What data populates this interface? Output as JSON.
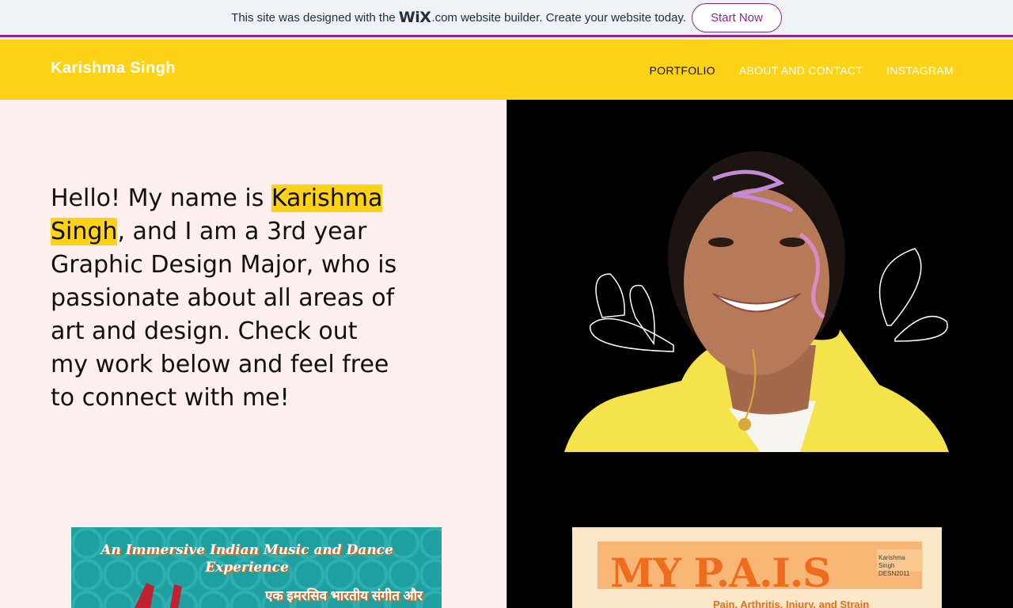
{
  "banner": {
    "text_before": "This site was designed with the",
    "wix_logo": "WiX",
    "text_after": ".com website builder. Create your website today.",
    "cta": "Start Now"
  },
  "header": {
    "site_title": "Karishma Singh",
    "nav": [
      {
        "label": "PORTFOLIO",
        "active": true
      },
      {
        "label": "ABOUT AND CONTACT",
        "active": false
      },
      {
        "label": "INSTAGRAM",
        "active": false
      }
    ]
  },
  "hero": {
    "intro_prefix": "Hello! My name is ",
    "name_line1": "Karishma",
    "name_line2": "Singh",
    "intro_suffix": ", and I am a 3rd year Graphic Design Major, who is passionate about all areas of art and design. Check out my work below and feel free to connect with me!",
    "portrait_icon": "portrait-photo"
  },
  "thumbnails": [
    {
      "title": "An Immersive Indian Music and Dance Experience",
      "subtitle": "एक इमरसिव भारतीय संगीत और"
    },
    {
      "title": "MY P.A.I.S",
      "credit": "Karishma Singh DESN2011",
      "subtitle": "Pain, Arthritis, Injury, and Strain"
    }
  ],
  "colors": {
    "accent_yellow": "#fed217",
    "wix_purple": "#8a2a8e",
    "panel_pink": "#fdf0ef"
  }
}
